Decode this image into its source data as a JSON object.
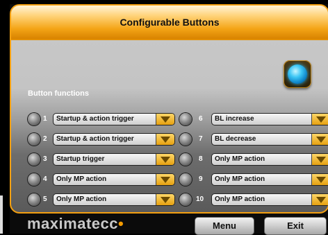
{
  "header": {
    "title": "Configurable Buttons"
  },
  "section": {
    "label": "Button functions"
  },
  "rows": [
    {
      "num": "1",
      "value": "Startup & action trigger"
    },
    {
      "num": "2",
      "value": "Startup & action trigger"
    },
    {
      "num": "3",
      "value": "Startup trigger"
    },
    {
      "num": "4",
      "value": "Only MP action"
    },
    {
      "num": "5",
      "value": "Only MP action"
    },
    {
      "num": "6",
      "value": "BL increase"
    },
    {
      "num": "7",
      "value": "BL decrease"
    },
    {
      "num": "8",
      "value": "Only MP action"
    },
    {
      "num": "9",
      "value": "Only MP action"
    },
    {
      "num": "10",
      "value": "Only MP action"
    }
  ],
  "footer": {
    "logo_text": "maximatecc",
    "logo_dot": "•",
    "menu_label": "Menu",
    "exit_label": "Exit"
  },
  "icons": {
    "led": "indicator-led-icon",
    "dropdown": "dropdown-arrow-icon",
    "preview": "button-preview-icon"
  },
  "colors": {
    "accent": "#f4a010",
    "led_active": "#3cc6f5"
  }
}
